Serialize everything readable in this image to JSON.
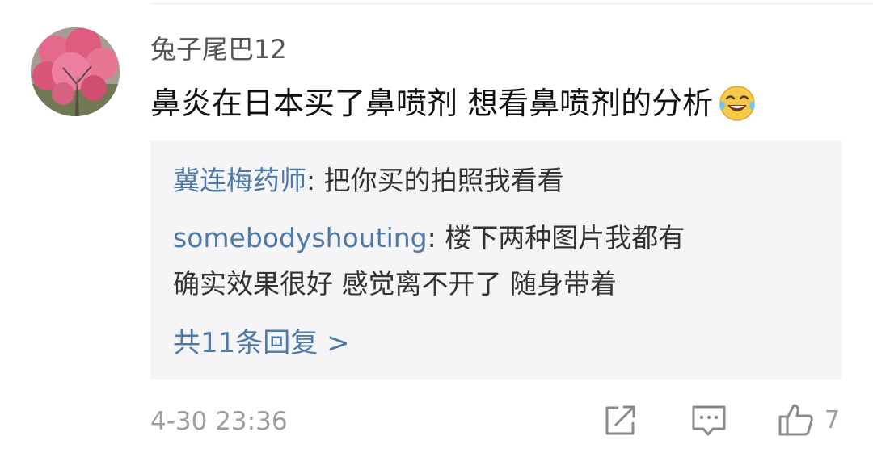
{
  "comment": {
    "username": "兔子尾巴12",
    "text": "鼻炎在日本买了鼻喷剂 想看鼻喷剂的分析",
    "emoji_icon": "laughing-with-tears-emoji",
    "timestamp": "4-30 23:36",
    "like_count": "7"
  },
  "replies": [
    {
      "author": "冀连梅药师",
      "separator": ": ",
      "text": "把你买的拍照我看看"
    },
    {
      "author": "somebodyshouting",
      "separator": ": ",
      "text": "楼下两种图片我都有",
      "text_continued": "确实效果很好 感觉离不开了 随身带着"
    }
  ],
  "more_replies_label": "共11条回复 >",
  "actions": {
    "share_icon": "share-icon",
    "comment_icon": "comment-icon",
    "like_icon": "thumbs-up-icon"
  },
  "colors": {
    "link_blue": "#4d7aa8",
    "reply_background": "#f5f5f7",
    "meta_gray": "#9e9e9e"
  }
}
